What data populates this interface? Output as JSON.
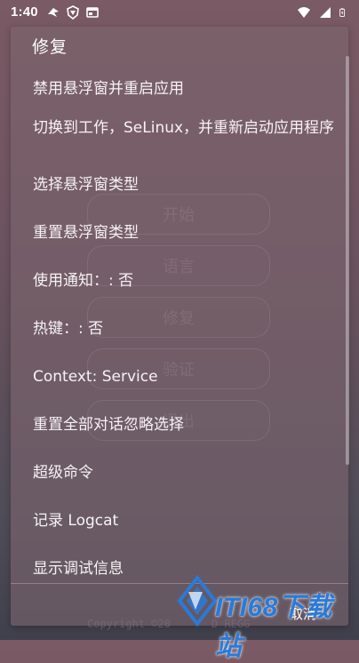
{
  "status_bar": {
    "time": "1:40",
    "icons_left": [
      "bird-app-icon",
      "shield-app-icon",
      "card-app-icon"
    ],
    "icons_right": [
      "wifi-icon",
      "signal-icon",
      "battery-icon"
    ]
  },
  "background": {
    "buttons": [
      "开始",
      "语言",
      "修复",
      "验证",
      "退出"
    ],
    "copyright": "Copyright ©20",
    "copyright_tail": "D REGG"
  },
  "dialog": {
    "title": "修复",
    "items": [
      "禁用悬浮窗并重启应用",
      "切换到工作，SeLinux，并重新启动应用程序",
      "选择悬浮窗类型",
      "重置悬浮窗类型",
      "使用通知：: 否",
      "热键：: 否",
      "Context: Service",
      "重置全部对话忽略选择",
      "超级命令",
      "记录 Logcat",
      "显示调试信息"
    ],
    "cancel_label": "取消"
  },
  "watermark": {
    "text": "ITI68下载站",
    "accent_color": "#2a7ad8"
  }
}
